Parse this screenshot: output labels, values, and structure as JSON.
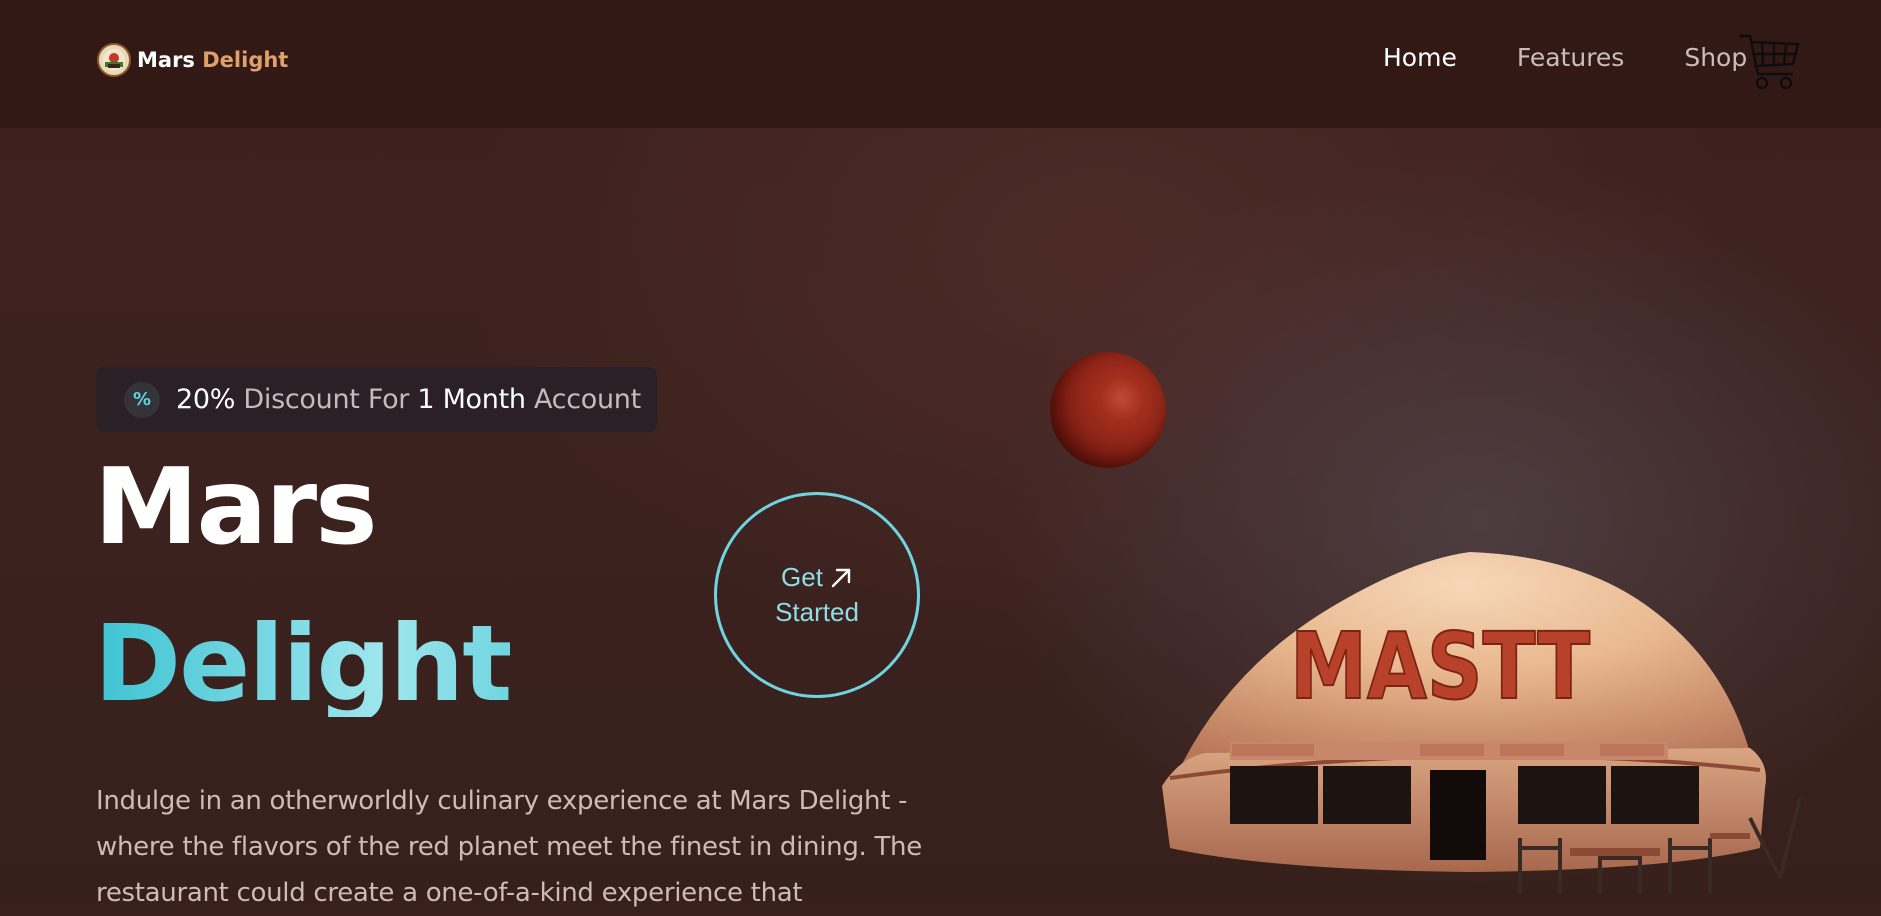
{
  "nav": {
    "brand_first": "Mars",
    "brand_second": "Delight",
    "links": [
      {
        "label": "Home",
        "active": true
      },
      {
        "label": "Features",
        "active": false
      },
      {
        "label": "Shop",
        "active": false
      }
    ],
    "cart_icon": "shopping-cart-icon"
  },
  "promo": {
    "icon": "percent-icon",
    "icon_glyph": "%",
    "percent": "20%",
    "discount_text": " Discount For ",
    "duration": "1 Month",
    "suffix": " Account"
  },
  "hero": {
    "title_line1": "Mars",
    "title_line2": "Delight",
    "cta_line1": "Get",
    "cta_line2": "Started",
    "cta_icon": "arrow-up-right-icon",
    "description": "Indulge in an otherworldly culinary experience at Mars Delight - where the flavors of the red planet meet the finest in dining. The restaurant could create a one-of-a-kind experience that",
    "dome_sign_text": "MASTT"
  },
  "colors": {
    "nav_bg": "#331915",
    "page_bg": "#3a201d",
    "accent_cyan": "#6fd3e0",
    "brand_orange": "#e0a06c",
    "planet_red": "#a12e1d"
  }
}
